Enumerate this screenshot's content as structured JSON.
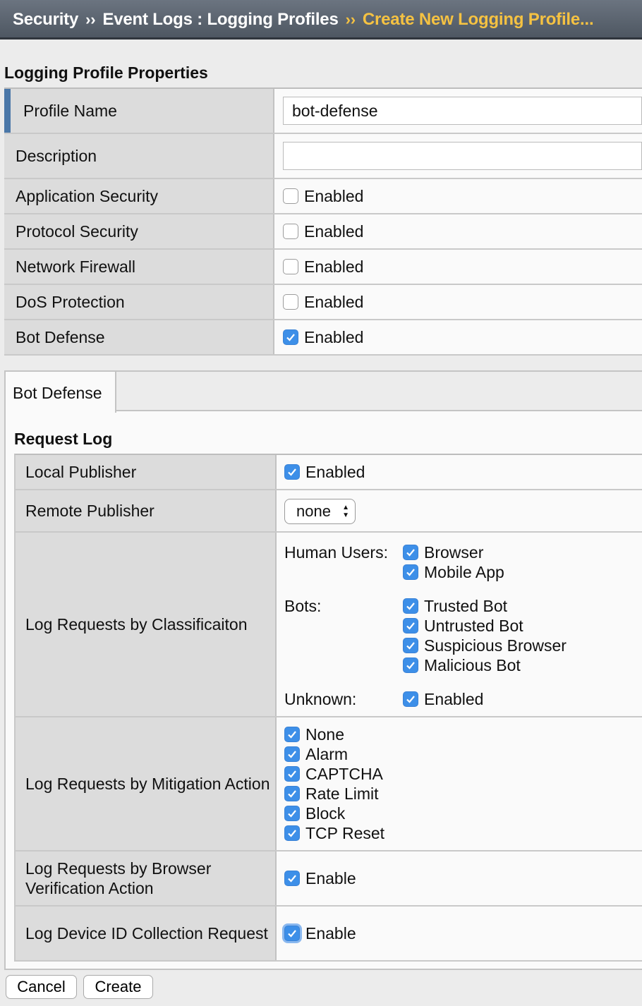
{
  "breadcrumb": {
    "items": [
      "Security",
      "Event Logs : Logging Profiles",
      "Create New Logging Profile..."
    ],
    "separator": "››"
  },
  "properties": {
    "title": "Logging Profile Properties",
    "profile_name": {
      "label": "Profile Name",
      "value": "bot-defense"
    },
    "description": {
      "label": "Description",
      "value": ""
    },
    "rows": [
      {
        "label": "Application Security",
        "option": "Enabled",
        "checked": false
      },
      {
        "label": "Protocol Security",
        "option": "Enabled",
        "checked": false
      },
      {
        "label": "Network Firewall",
        "option": "Enabled",
        "checked": false
      },
      {
        "label": "DoS Protection",
        "option": "Enabled",
        "checked": false
      },
      {
        "label": "Bot Defense",
        "option": "Enabled",
        "checked": true
      }
    ]
  },
  "tabs": {
    "active": "Bot Defense"
  },
  "request_log": {
    "title": "Request Log",
    "local_publisher": {
      "label": "Local Publisher",
      "option": "Enabled",
      "checked": true
    },
    "remote_publisher": {
      "label": "Remote Publisher",
      "selected": "none"
    },
    "classification": {
      "label": "Log Requests by Classificaiton",
      "human_users_label": "Human Users:",
      "human_users": [
        "Browser",
        "Mobile App"
      ],
      "bots_label": "Bots:",
      "bots": [
        "Trusted Bot",
        "Untrusted Bot",
        "Suspicious Browser",
        "Malicious Bot"
      ],
      "unknown_label": "Unknown:",
      "unknown": "Enabled"
    },
    "mitigation": {
      "label": "Log Requests by Mitigation Action",
      "options": [
        "None",
        "Alarm",
        "CAPTCHA",
        "Rate Limit",
        "Block",
        "TCP Reset"
      ]
    },
    "browser_verification": {
      "label": "Log Requests by Browser Verification Action",
      "option": "Enable",
      "checked": true
    },
    "device_id": {
      "label": "Log Device ID Collection Request",
      "option": "Enable",
      "checked": true
    }
  },
  "buttons": {
    "cancel": "Cancel",
    "create": "Create"
  },
  "colors": {
    "accent": "#4a77a8",
    "checkbox": "#3d8fe8",
    "breadcrumb_current": "#f5c242"
  }
}
